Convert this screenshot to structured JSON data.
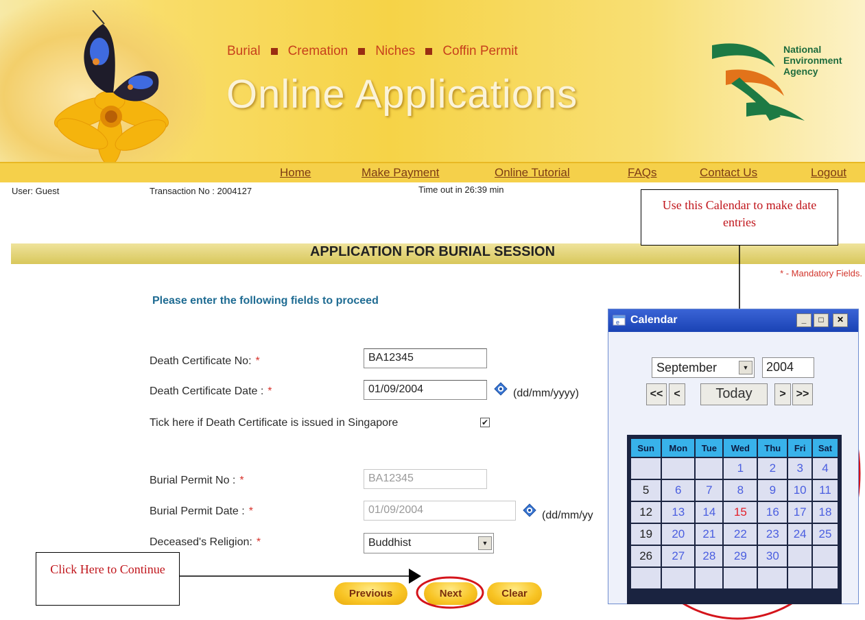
{
  "header": {
    "services": [
      "Burial",
      "Cremation",
      "Niches",
      "Coffin Permit"
    ],
    "title": "Online Applications",
    "agency_lines": [
      "National",
      "Environment",
      "Agency"
    ]
  },
  "nav": {
    "items": [
      "Home",
      "Make Payment",
      "Online Tutorial",
      "FAQs",
      "Contact Us",
      "Logout"
    ]
  },
  "status": {
    "user": "User: Guest",
    "transaction": "Transaction No : 2004127",
    "timeout": "Time out in 26:39 min"
  },
  "page": {
    "section_title": "APPLICATION FOR BURIAL SESSION",
    "mandatory_note": "* - Mandatory Fields.",
    "intro": "Please enter the following fields to proceed"
  },
  "form": {
    "death_cert_no": {
      "label": "Death Certificate No:",
      "required": "*",
      "value": "BA12345"
    },
    "death_cert_date": {
      "label": "Death Certificate Date :",
      "required": "*",
      "value": "01/09/2004",
      "format": "(dd/mm/yyyy)"
    },
    "singapore_check": {
      "label": "Tick here if Death Certificate is issued in Singapore",
      "checked": "✔"
    },
    "burial_permit_no": {
      "label": "Burial Permit No :",
      "required": "*",
      "value": "BA12345"
    },
    "burial_permit_date": {
      "label": "Burial Permit Date :",
      "required": "*",
      "value": "01/09/2004",
      "format": "(dd/mm/yy"
    },
    "religion": {
      "label": "Deceased's Religion:",
      "required": "*",
      "value": "Buddhist"
    }
  },
  "buttons": {
    "previous": "Previous",
    "next": "Next",
    "clear": "Clear"
  },
  "callouts": {
    "calendar": "Use this Calendar to make date entries",
    "continue": "Click Here to Continue"
  },
  "calendar": {
    "window_title": "Calendar",
    "month": "September",
    "year": "2004",
    "nav": {
      "prev_year": "<<",
      "prev_month": "<",
      "today": "Today",
      "next_month": ">",
      "next_year": ">>"
    },
    "weekdays": [
      "Sun",
      "Mon",
      "Tue",
      "Wed",
      "Thu",
      "Fri",
      "Sat"
    ],
    "weeks": [
      [
        "",
        "",
        "",
        "1",
        "2",
        "3",
        "4"
      ],
      [
        "5",
        "6",
        "7",
        "8",
        "9",
        "10",
        "11"
      ],
      [
        "12",
        "13",
        "14",
        "15",
        "16",
        "17",
        "18"
      ],
      [
        "19",
        "20",
        "21",
        "22",
        "23",
        "24",
        "25"
      ],
      [
        "26",
        "27",
        "28",
        "29",
        "30",
        "",
        ""
      ],
      [
        "",
        "",
        "",
        "",
        "",
        "",
        ""
      ]
    ],
    "highlighted_day": "15"
  }
}
